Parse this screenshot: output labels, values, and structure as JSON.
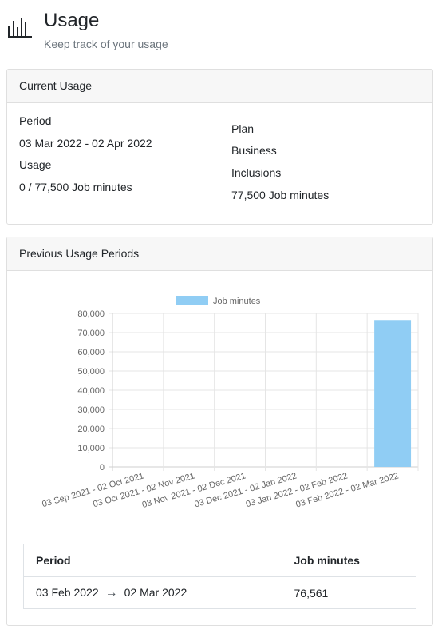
{
  "page": {
    "title": "Usage",
    "subtitle": "Keep track of your usage",
    "icon": "bar-chart-icon"
  },
  "current_usage": {
    "heading": "Current Usage",
    "period_label": "Period",
    "period_value": "03 Mar 2022 - 02 Apr 2022",
    "usage_label": "Usage",
    "usage_value": "0 / 77,500 Job minutes",
    "plan_label": "Plan",
    "plan_value": "Business",
    "inclusions_label": "Inclusions",
    "inclusions_value": "77,500 Job minutes"
  },
  "previous_usage": {
    "heading": "Previous Usage Periods",
    "table": {
      "headers": [
        "Period",
        "Job minutes"
      ],
      "rows": [
        {
          "start": "03 Feb 2022",
          "arrow": "→",
          "end": "02 Mar 2022",
          "minutes": "76,561"
        }
      ]
    }
  },
  "colors": {
    "bar": "#90cdf4",
    "grid": "#e5e5e5",
    "card_header_bg": "#f7f7f7"
  },
  "chart_data": {
    "type": "bar",
    "categories": [
      "03 Sep 2021 - 02 Oct 2021",
      "03 Oct 2021 - 02 Nov 2021",
      "03 Nov 2021 - 02 Dec 2021",
      "03 Dec 2021 - 02 Jan 2022",
      "03 Jan 2022 - 02 Feb 2022",
      "03 Feb 2022 - 02 Mar 2022"
    ],
    "series": [
      {
        "name": "Job minutes",
        "values": [
          0,
          0,
          0,
          0,
          0,
          76561
        ]
      }
    ],
    "yticks": [
      "0",
      "10,000",
      "20,000",
      "30,000",
      "40,000",
      "50,000",
      "60,000",
      "70,000",
      "80,000"
    ],
    "ylim": [
      0,
      80000
    ],
    "legend": "top",
    "grid": true
  }
}
